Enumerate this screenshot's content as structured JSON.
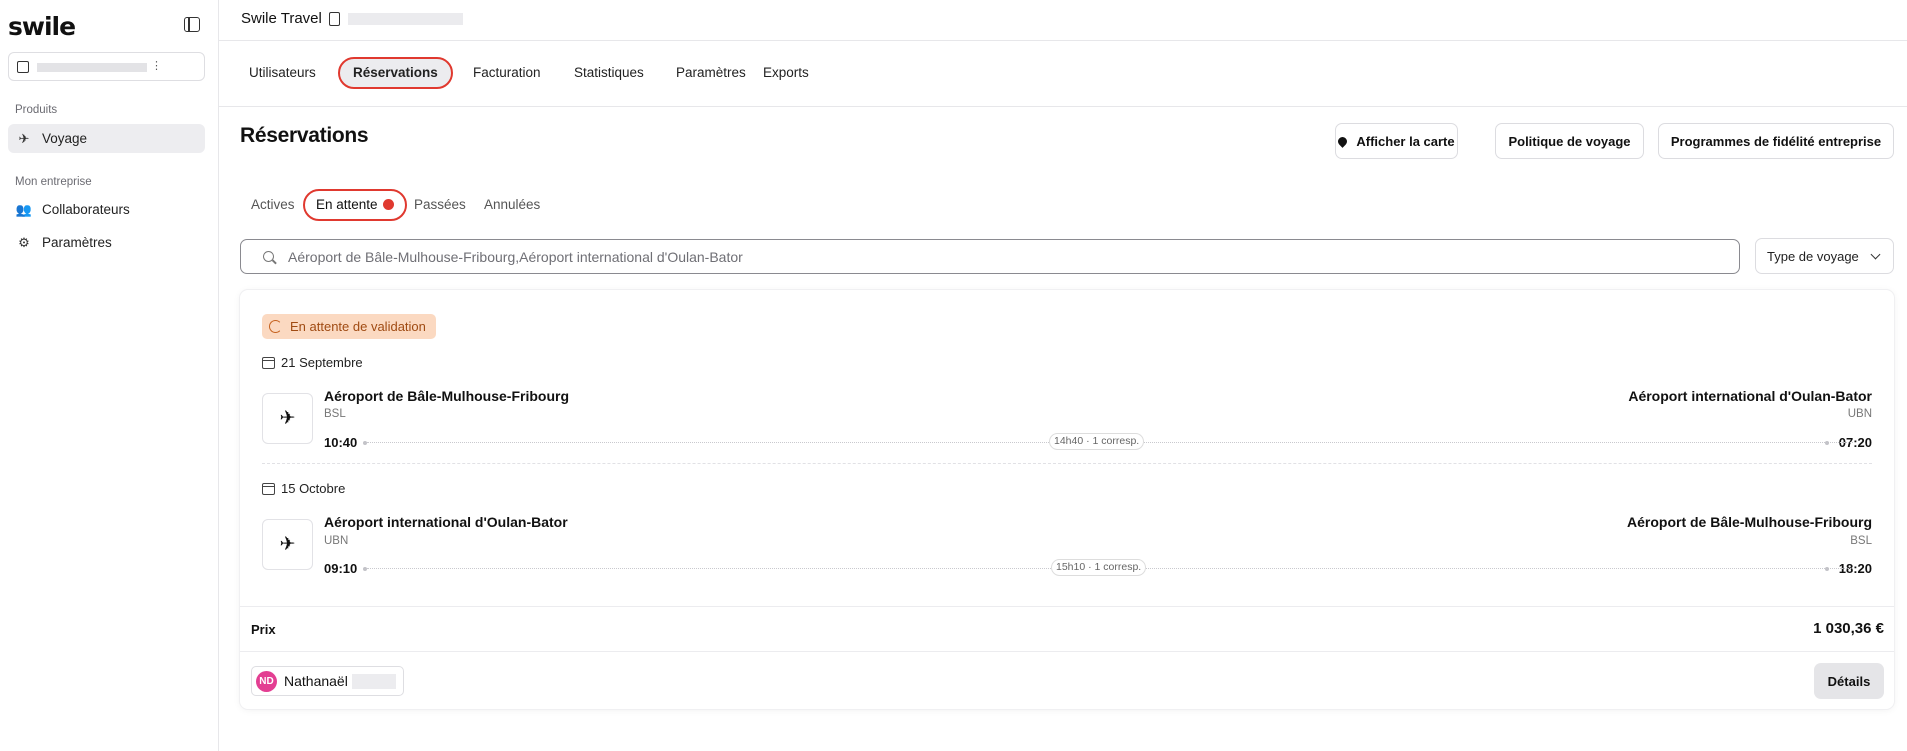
{
  "brand": {
    "logo_text": "swile"
  },
  "sidebar": {
    "sections": [
      {
        "title": "Produits",
        "items": [
          {
            "label": "Voyage",
            "icon": "plane-icon",
            "active": true
          }
        ]
      },
      {
        "title": "Mon entreprise",
        "items": [
          {
            "label": "Collaborateurs",
            "icon": "users-icon",
            "active": false
          },
          {
            "label": "Paramètres",
            "icon": "settings-icon",
            "active": false
          }
        ]
      }
    ]
  },
  "header": {
    "title": "Swile Travel"
  },
  "nav": {
    "tabs": [
      {
        "label": "Utilisateurs"
      },
      {
        "label": "Réservations",
        "active": true
      },
      {
        "label": "Facturation"
      },
      {
        "label": "Statistiques"
      },
      {
        "label": "Paramètres"
      },
      {
        "label": "Exports"
      }
    ]
  },
  "page": {
    "title": "Réservations",
    "actions": {
      "map": "Afficher la carte",
      "policy": "Politique de voyage",
      "loyalty": "Programmes de fidélité entreprise"
    }
  },
  "subtabs": [
    {
      "label": "Actives"
    },
    {
      "label": "En attente",
      "active": true,
      "indicator": true
    },
    {
      "label": "Passées"
    },
    {
      "label": "Annulées"
    }
  ],
  "search": {
    "placeholder": "Aéroport de Bâle-Mulhouse-Fribourg,Aéroport international d'Oulan-Bator",
    "value": ""
  },
  "filter": {
    "label": "Type de voyage"
  },
  "booking": {
    "status": "En attente de validation",
    "status_colors": {
      "background": "#fbd9c1",
      "text": "#a04b13"
    },
    "segments": [
      {
        "date": "21 Septembre",
        "from": {
          "name": "Aéroport de Bâle-Mulhouse-Fribourg",
          "code": "BSL",
          "time": "10:40"
        },
        "to": {
          "name": "Aéroport international d'Oulan-Bator",
          "code": "UBN",
          "time": "07:20"
        },
        "info": "14h40 · 1 corresp."
      },
      {
        "date": "15 Octobre",
        "from": {
          "name": "Aéroport international d'Oulan-Bator",
          "code": "UBN",
          "time": "09:10"
        },
        "to": {
          "name": "Aéroport de Bâle-Mulhouse-Fribourg",
          "code": "BSL",
          "time": "18:20"
        },
        "info": "15h10 · 1 corresp."
      }
    ],
    "price_label": "Prix",
    "price": "1 030,36 €",
    "traveler": {
      "initials": "ND",
      "first_name": "Nathanaël",
      "avatar_color": "#e33e92"
    },
    "details_label": "Détails"
  },
  "accent_color": "#e0392f"
}
